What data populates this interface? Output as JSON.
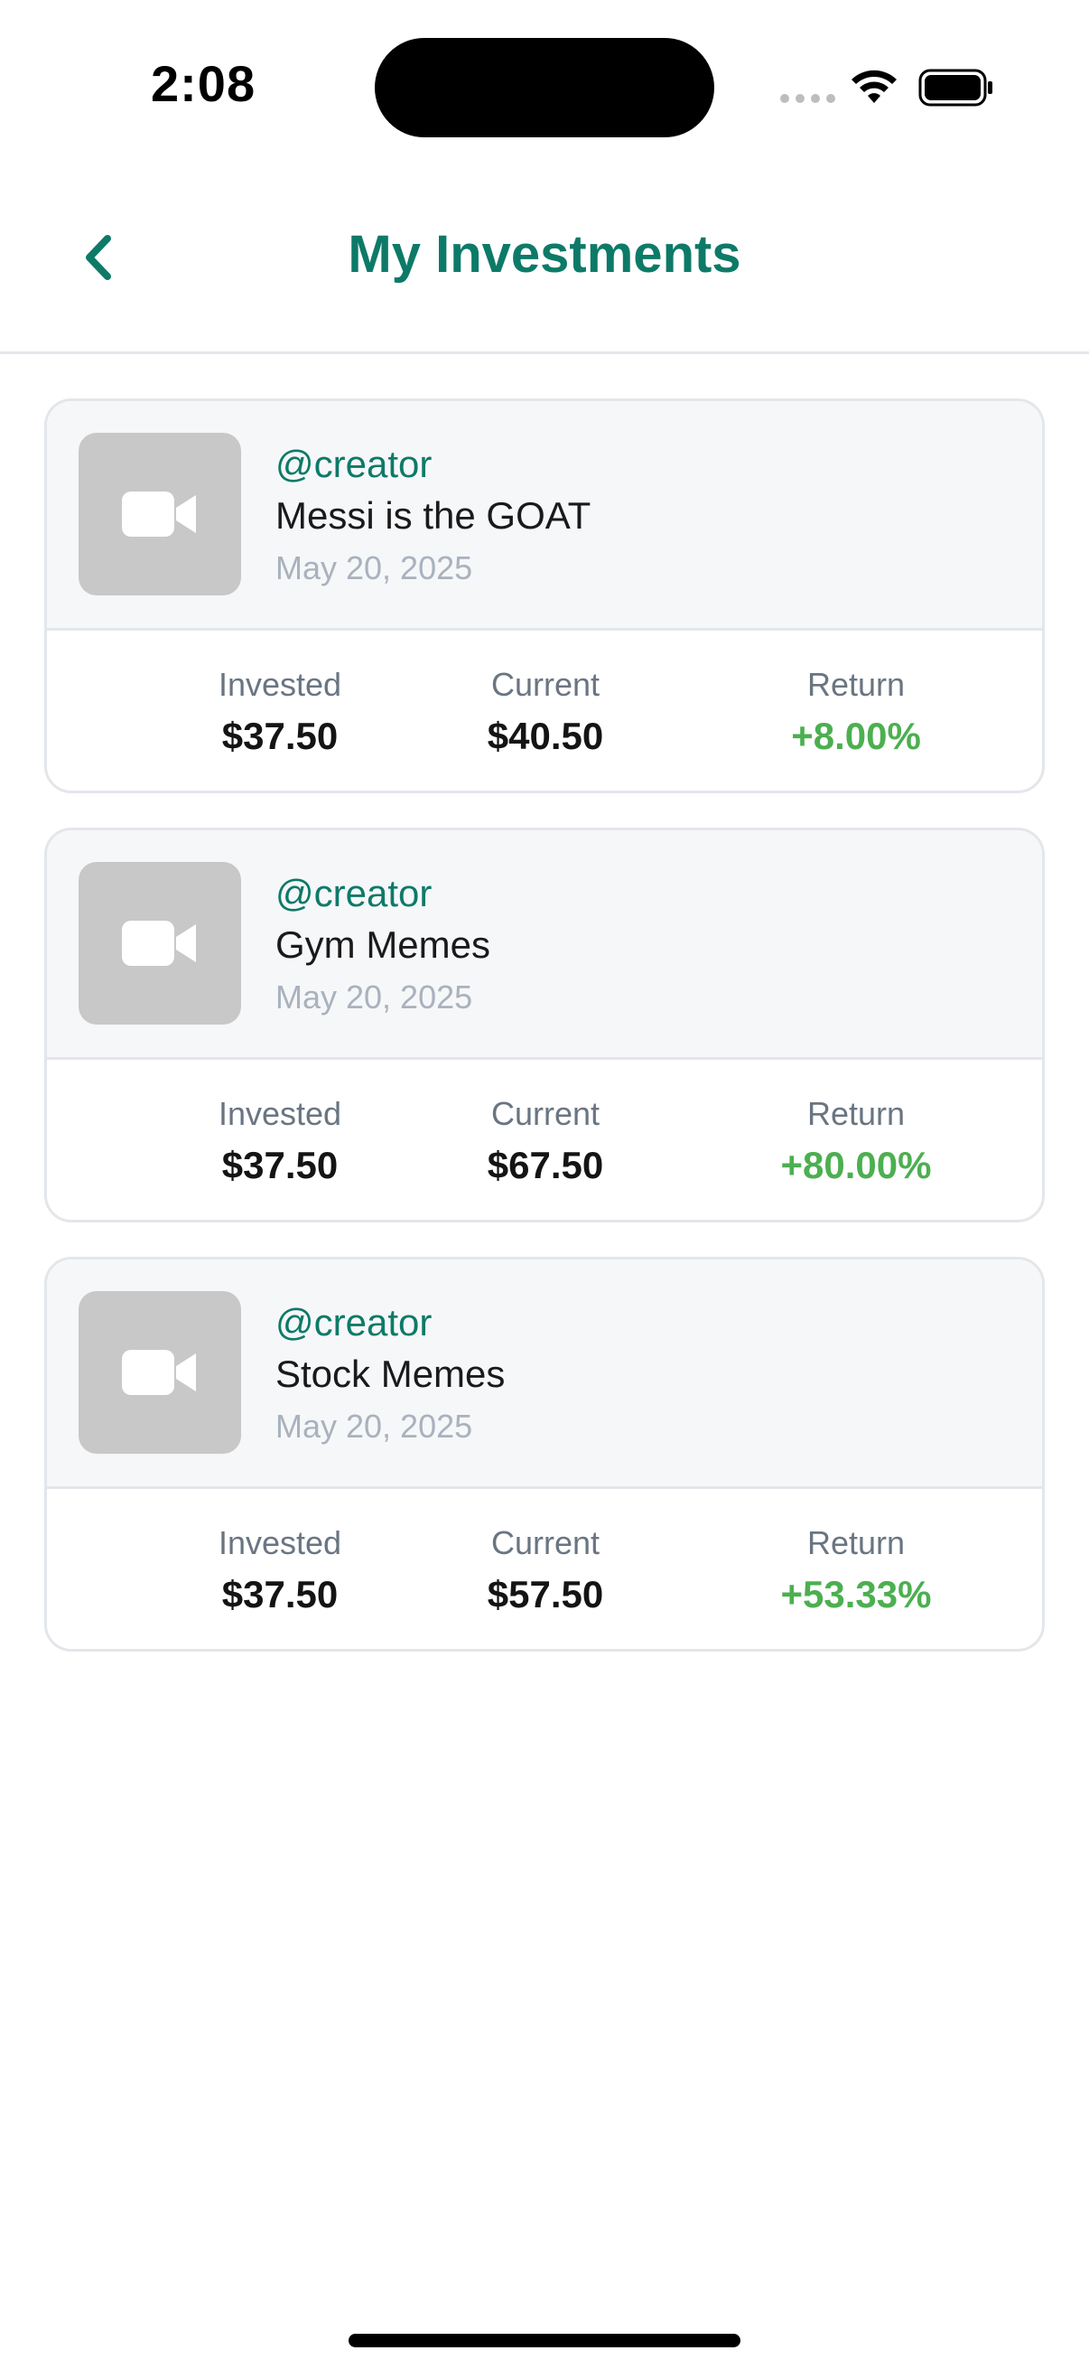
{
  "status_bar": {
    "time": "2:08",
    "icons": [
      "signal-dots-icon",
      "wifi-icon",
      "battery-icon"
    ]
  },
  "header": {
    "title": "My Investments",
    "back_icon": "chevron-left-icon"
  },
  "colors": {
    "brand": "#0d7a68",
    "positive": "#4caf50",
    "card_top_bg": "#f6f7f9",
    "border": "#e3e6ea",
    "thumb_bg": "#c8c8c8"
  },
  "investments": [
    {
      "creator": "@creator",
      "title": "Messi is the GOAT",
      "date": "May 20, 2025",
      "thumbnail_icon": "video-camera-icon",
      "invested_label": "Invested",
      "invested": "$37.50",
      "current_label": "Current",
      "current": "$40.50",
      "return_label": "Return",
      "return": "+8.00%"
    },
    {
      "creator": "@creator",
      "title": "Gym Memes",
      "date": "May 20, 2025",
      "thumbnail_icon": "video-camera-icon",
      "invested_label": "Invested",
      "invested": "$37.50",
      "current_label": "Current",
      "current": "$67.50",
      "return_label": "Return",
      "return": "+80.00%"
    },
    {
      "creator": "@creator",
      "title": "Stock Memes",
      "date": "May 20, 2025",
      "thumbnail_icon": "video-camera-icon",
      "invested_label": "Invested",
      "invested": "$37.50",
      "current_label": "Current",
      "current": "$57.50",
      "return_label": "Return",
      "return": "+53.33%"
    }
  ]
}
